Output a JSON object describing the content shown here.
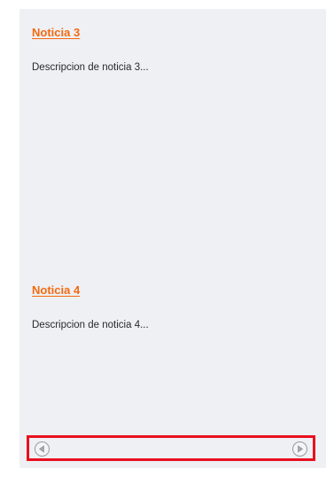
{
  "news": [
    {
      "title": "Noticia 3",
      "description": "Descripcion de noticia 3..."
    },
    {
      "title": "Noticia 4",
      "description": "Descripcion de noticia 4..."
    }
  ],
  "navigation": {
    "prev_icon": "arrow-left-circle-icon",
    "next_icon": "arrow-right-circle-icon"
  },
  "colors": {
    "panel_background": "#eef0f4",
    "link": "#f26a10",
    "highlight_border": "#e8101f"
  }
}
